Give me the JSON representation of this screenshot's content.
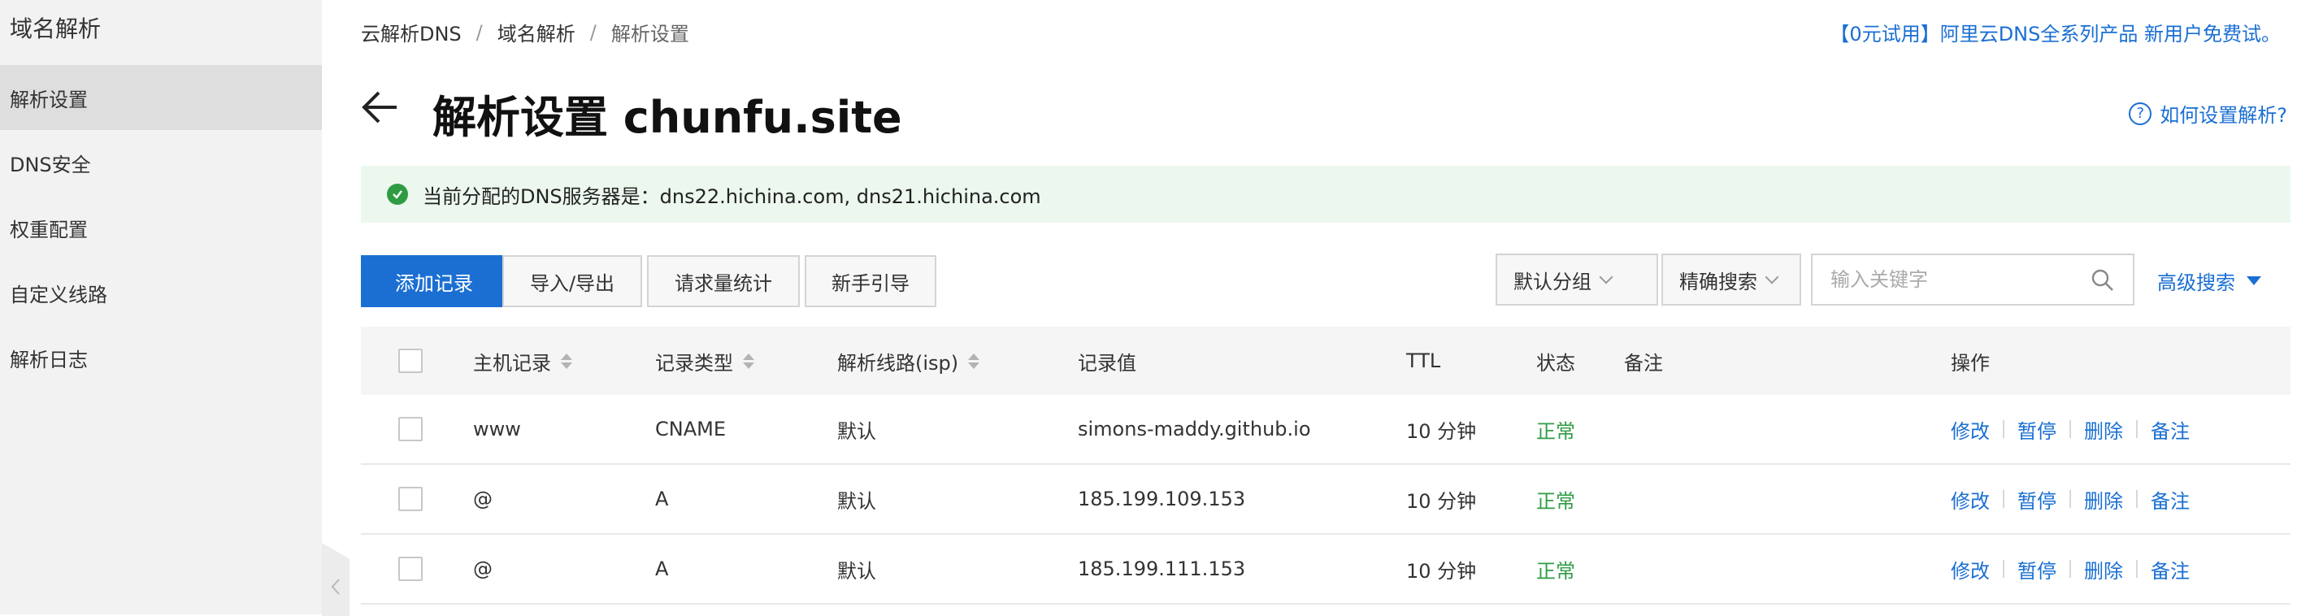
{
  "sidebar": {
    "title": "域名解析",
    "items": [
      {
        "label": "解析设置",
        "active": true
      },
      {
        "label": "DNS安全",
        "active": false
      },
      {
        "label": "权重配置",
        "active": false
      },
      {
        "label": "自定义线路",
        "active": false
      },
      {
        "label": "解析日志",
        "active": false
      }
    ]
  },
  "breadcrumb": [
    "云解析DNS",
    "域名解析",
    "解析设置"
  ],
  "promo": "【0元试用】阿里云DNS全系列产品 新用户免费试。",
  "page_title": "解析设置 chunfu.site",
  "help_link": "如何设置解析?",
  "notice": "当前分配的DNS服务器是：dns22.hichina.com, dns21.hichina.com",
  "toolbar": {
    "add_record": "添加记录",
    "import_export": "导入/导出",
    "request_stats": "请求量统计",
    "guide": "新手引导",
    "group_select": "默认分组",
    "search_mode": "精确搜索",
    "search_placeholder": "输入关键字",
    "advanced_search": "高级搜索"
  },
  "table": {
    "headers": {
      "host": "主机记录",
      "type": "记录类型",
      "line": "解析线路(isp)",
      "value": "记录值",
      "ttl": "TTL",
      "status": "状态",
      "remark": "备注",
      "actions": "操作"
    },
    "actions": [
      "修改",
      "暂停",
      "删除",
      "备注"
    ],
    "rows": [
      {
        "host": "www",
        "type": "CNAME",
        "line": "默认",
        "value": "simons-maddy.github.io",
        "ttl": "10 分钟",
        "status": "正常",
        "remark": ""
      },
      {
        "host": "@",
        "type": "A",
        "line": "默认",
        "value": "185.199.109.153",
        "ttl": "10 分钟",
        "status": "正常",
        "remark": ""
      },
      {
        "host": "@",
        "type": "A",
        "line": "默认",
        "value": "185.199.111.153",
        "ttl": "10 分钟",
        "status": "正常",
        "remark": ""
      }
    ]
  },
  "colors": {
    "primary": "#1b6fd3",
    "link": "#1a6fd3",
    "success": "#2f9c43",
    "notice_bg": "#ecf8ee"
  }
}
